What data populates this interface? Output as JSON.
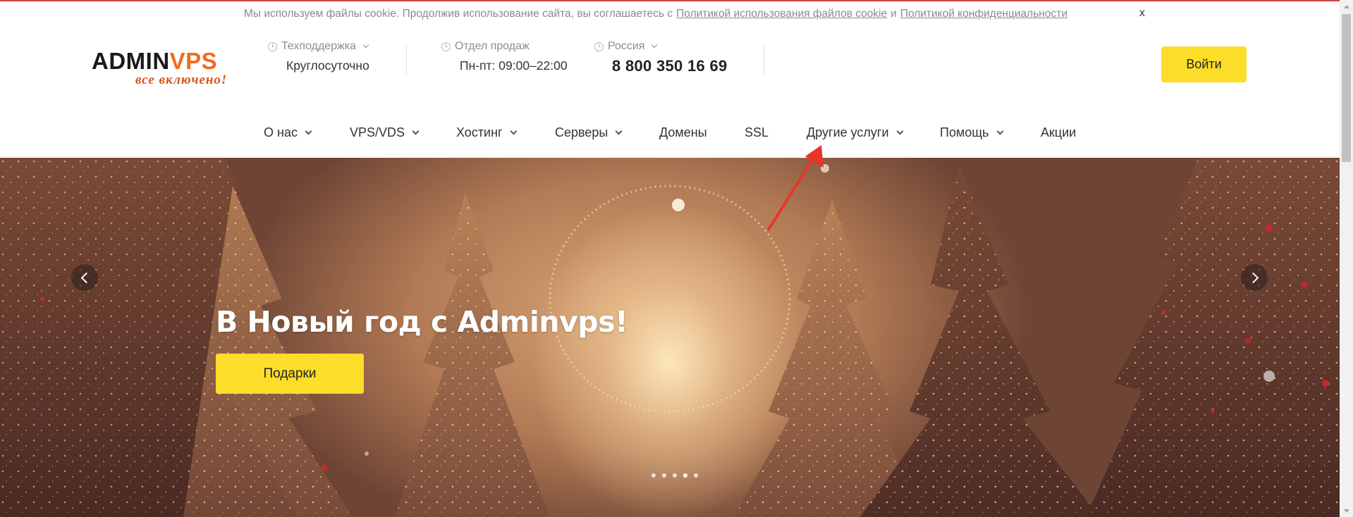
{
  "cookie_bar": {
    "text": "Мы используем файлы cookie. Продолжив использование сайта, вы соглашаетесь с",
    "link1": "Политикой использования файлов cookie",
    "conj": "и",
    "link2": "Политикой конфиденциальности",
    "close": "x"
  },
  "header": {
    "logo": {
      "part1": "ADMIN",
      "part2": "V",
      "part3": "PS",
      "tagline": "все включено!"
    },
    "support": {
      "label": "Техподдержка",
      "value": "Круглосуточно"
    },
    "sales": {
      "label": "Отдел продаж",
      "value": "Пн-пт: 09:00–22:00"
    },
    "region": {
      "label": "Россия",
      "phone": "8 800 350 16 69"
    },
    "login": "Войти"
  },
  "nav": {
    "items": [
      {
        "label": "О нас"
      },
      {
        "label": "VPS/VDS"
      },
      {
        "label": "Хостинг"
      },
      {
        "label": "Серверы"
      },
      {
        "label": "Домены"
      },
      {
        "label": "SSL"
      },
      {
        "label": "Другие услуги"
      },
      {
        "label": "Помощь"
      },
      {
        "label": "Акции"
      }
    ]
  },
  "hero": {
    "title": "В Новый год с Adminvps!",
    "button": "Подарки",
    "slides_count": 5,
    "active_slide": 3
  },
  "colors": {
    "accent_yellow": "#fbdd2a",
    "brand_orange": "#f26a1b",
    "annotation_red": "#e8352a"
  }
}
